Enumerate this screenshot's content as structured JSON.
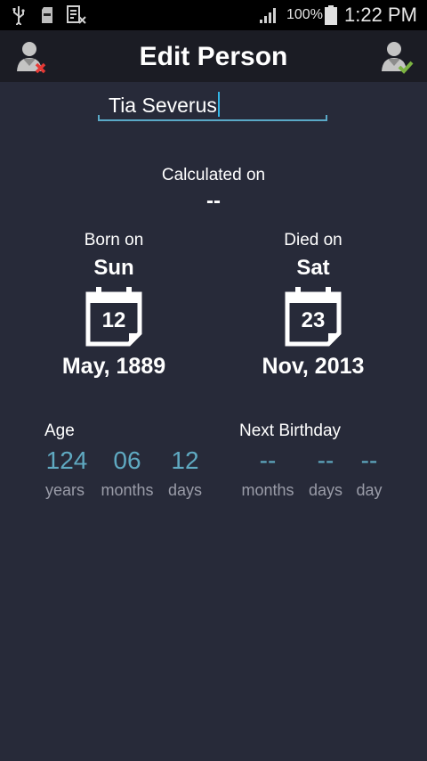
{
  "status_bar": {
    "battery_percent": "100%",
    "time": "1:22 PM",
    "icons": [
      "usb-icon",
      "sd-card-icon",
      "sim-card-icon",
      "signal-icon",
      "battery-icon"
    ]
  },
  "app_bar": {
    "title": "Edit Person",
    "left_action_icon": "remove-person-icon",
    "right_action_icon": "save-person-icon"
  },
  "person": {
    "name": "Tia Severus"
  },
  "calculated": {
    "label": "Calculated on",
    "value": "--"
  },
  "born": {
    "label": "Born on",
    "weekday": "Sun",
    "day": "12",
    "month_year": "May, 1889"
  },
  "died": {
    "label": "Died on",
    "weekday": "Sat",
    "day": "23",
    "month_year": "Nov, 2013"
  },
  "age": {
    "label": "Age",
    "years": "124",
    "months": "06",
    "days": "12",
    "years_unit": "years",
    "months_unit": "months",
    "days_unit": "days"
  },
  "next_birthday": {
    "label": "Next Birthday",
    "months": "--",
    "days": "--",
    "day": "--",
    "months_unit": "months",
    "days_unit": "days",
    "day_unit": "day"
  },
  "colors": {
    "background": "#272a39",
    "app_bar": "#1b1c24",
    "accent": "#5fa9c1",
    "unit_text": "#9a9ca8"
  }
}
